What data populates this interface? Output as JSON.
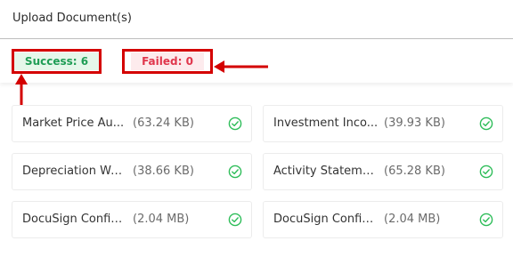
{
  "header": {
    "title": "Upload Document(s)"
  },
  "status": {
    "success_label": "Success: 6",
    "failed_label": "Failed: 0"
  },
  "colors": {
    "success_text": "#1f9d55",
    "success_bg": "#e6f7ea",
    "failed_text": "#e0364c",
    "failed_bg": "#fdebed",
    "annotation_red": "#d40000",
    "check_green": "#2ebd59"
  },
  "files": [
    {
      "name": "Market Price Au...",
      "size": "(63.24 KB)",
      "status_icon": "check-circle-icon"
    },
    {
      "name": "Investment Inco...",
      "size": "(39.93 KB)",
      "status_icon": "check-circle-icon"
    },
    {
      "name": "Depreciation Wo...",
      "size": "(38.66 KB)",
      "status_icon": "check-circle-icon"
    },
    {
      "name": "Activity Stateme...",
      "size": "(65.28 KB)",
      "status_icon": "check-circle-icon"
    },
    {
      "name": "DocuSign Config...",
      "size": "(2.04 MB)",
      "status_icon": "check-circle-icon"
    },
    {
      "name": "DocuSign Config...",
      "size": "(2.04 MB)",
      "status_icon": "check-circle-icon"
    }
  ]
}
